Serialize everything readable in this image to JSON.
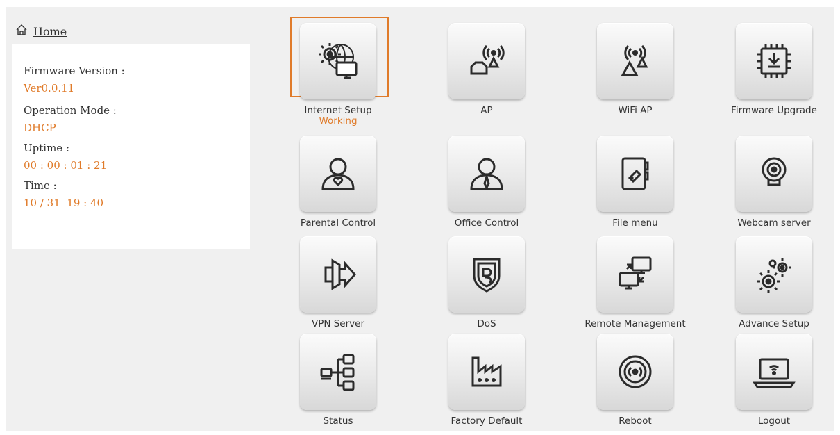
{
  "breadcrumb": {
    "home_label": "Home"
  },
  "info": {
    "firmware_label": "Firmware Version :",
    "firmware_value": "Ver0.0.11",
    "mode_label": "Operation Mode :",
    "mode_value": "DHCP",
    "uptime_label": "Uptime :",
    "uptime_value": "00 : 00 : 01 : 21",
    "time_label": "Time :",
    "time_value": "10 / 31  19 : 40"
  },
  "colors": {
    "accent": "#e07b2a",
    "text": "#333333",
    "icon": "#2b2b2b"
  },
  "tiles": [
    {
      "label": "Internet Setup",
      "status": "Working",
      "icon": "globe-gear-monitor-icon",
      "selected": true
    },
    {
      "label": "AP",
      "icon": "access-point-icon"
    },
    {
      "label": "WiFi AP",
      "icon": "wifi-antenna-icon"
    },
    {
      "label": "Firmware Upgrade",
      "icon": "chip-download-icon"
    },
    {
      "label": "Parental Control",
      "icon": "parent-heart-icon"
    },
    {
      "label": "Office Control",
      "icon": "office-person-tie-icon"
    },
    {
      "label": "File menu",
      "icon": "file-folder-icon"
    },
    {
      "label": "Webcam server",
      "icon": "webcam-icon"
    },
    {
      "label": "VPN Server",
      "icon": "vpn-door-arrow-icon"
    },
    {
      "label": "DoS",
      "icon": "shield-icon"
    },
    {
      "label": "Remote Management",
      "icon": "remote-screens-icon"
    },
    {
      "label": "Advance Setup",
      "icon": "gears-icon"
    },
    {
      "label": "Status",
      "icon": "network-tree-icon"
    },
    {
      "label": "Factory Default",
      "icon": "factory-icon"
    },
    {
      "label": "Reboot",
      "icon": "reboot-signal-icon"
    },
    {
      "label": "Logout",
      "icon": "laptop-wifi-icon"
    }
  ]
}
